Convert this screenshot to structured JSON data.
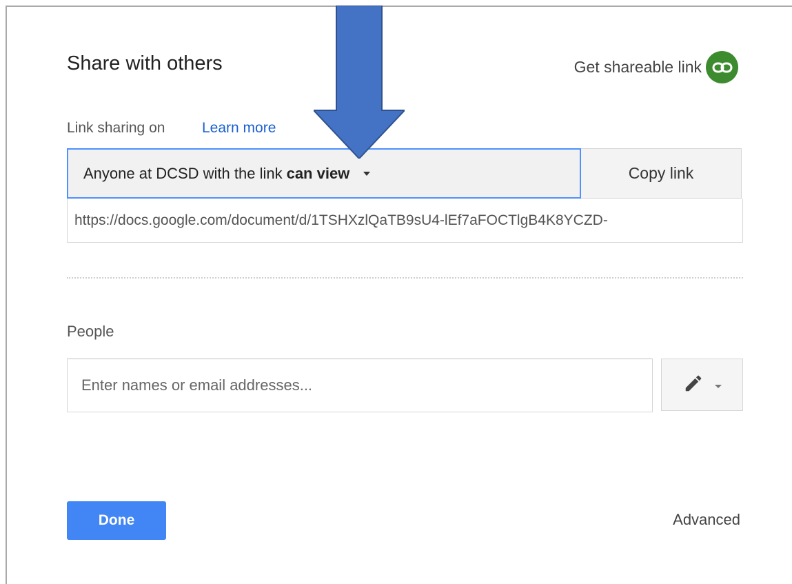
{
  "dialog": {
    "title": "Share with others",
    "get_link_label": "Get shareable link",
    "link_status": "Link sharing on",
    "learn_more": "Learn more",
    "access": {
      "prefix": "Anyone at DCSD with the link",
      "permission": "can view"
    },
    "copy_link_label": "Copy link",
    "url": "https://docs.google.com/document/d/1TSHXzlQaTB9sU4-lEf7aFOCTlgB4K8YCZD-",
    "people_label": "People",
    "people_placeholder": "Enter names or email addresses...",
    "done_label": "Done",
    "advanced_label": "Advanced"
  },
  "colors": {
    "accent_blue": "#4285f4",
    "link_green": "#3d8b2f",
    "focus_border": "#4d90fe",
    "annotation_arrow": "#4472c4"
  },
  "icons": {
    "shareable_link": "link-icon",
    "permission": "pencil-icon",
    "annotation": "down-arrow-icon"
  }
}
